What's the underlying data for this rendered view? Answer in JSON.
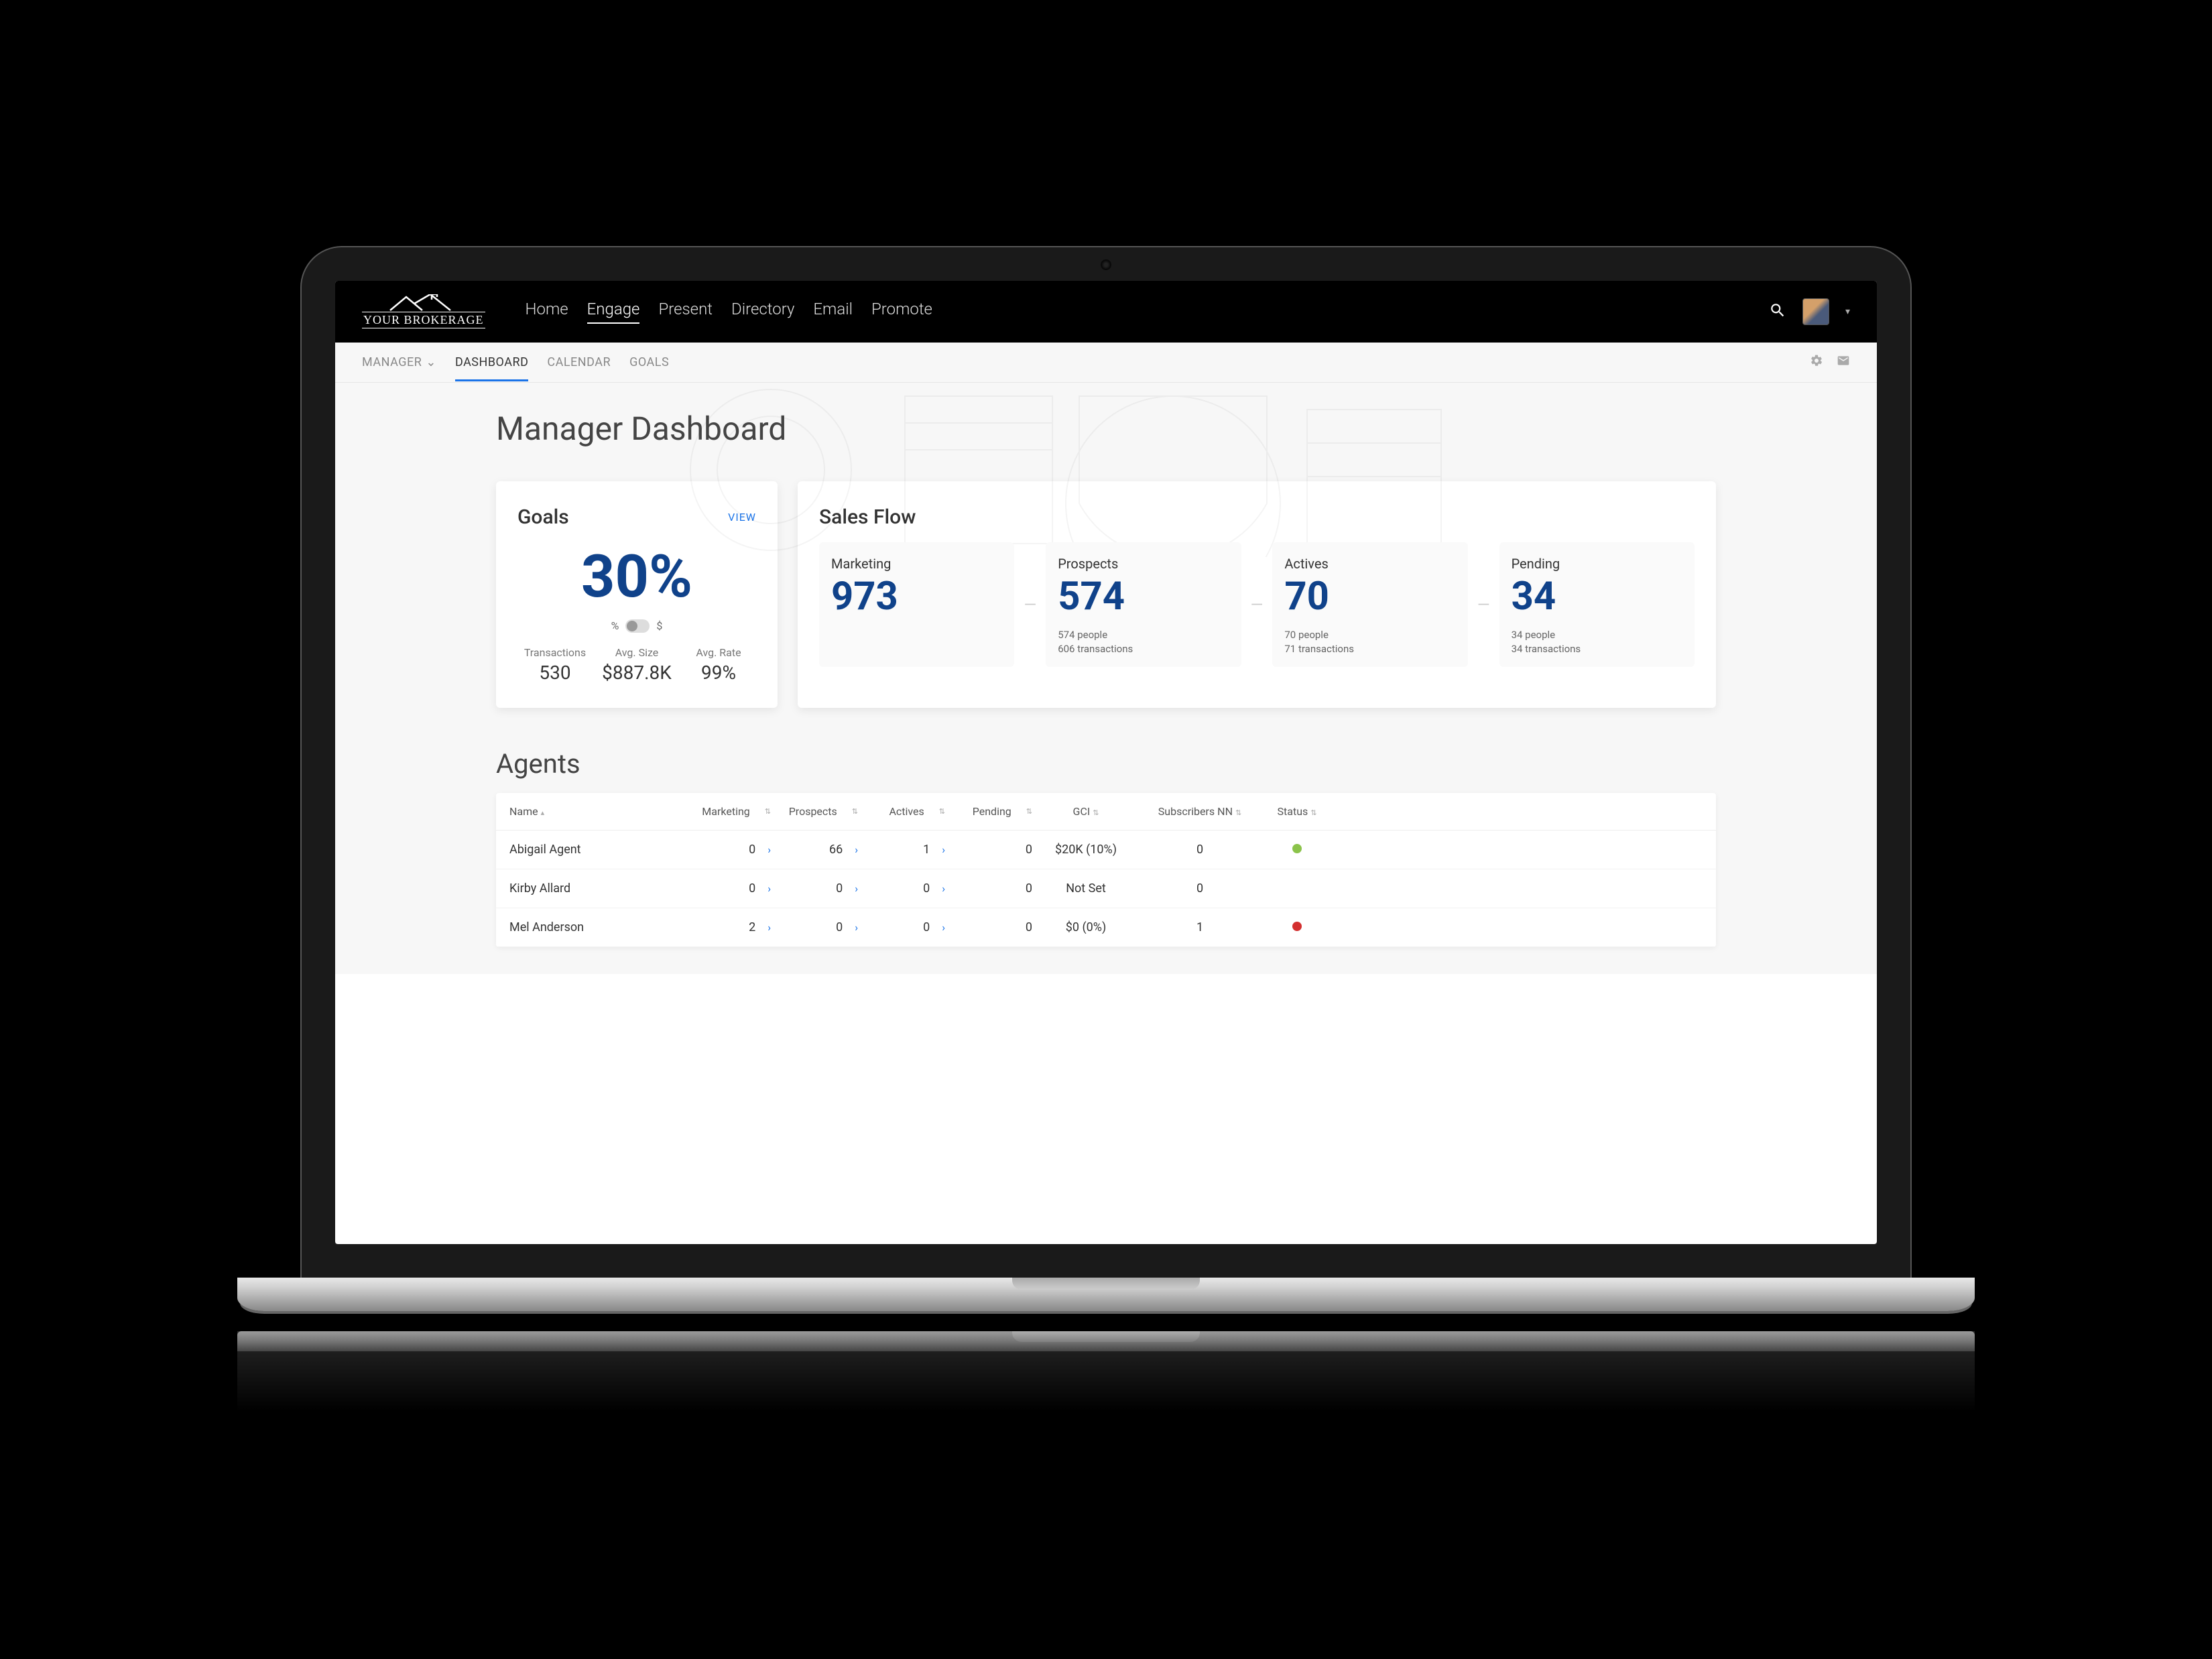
{
  "brand": "YOUR BROKERAGE",
  "nav": {
    "items": [
      "Home",
      "Engage",
      "Present",
      "Directory",
      "Email",
      "Promote"
    ],
    "active": "Engage"
  },
  "subnav": {
    "manager_label": "MANAGER",
    "items": [
      "DASHBOARD",
      "CALENDAR",
      "GOALS"
    ],
    "active": "DASHBOARD"
  },
  "page_title": "Manager Dashboard",
  "goals": {
    "title": "Goals",
    "view_label": "VIEW",
    "percent": "30%",
    "toggle_left": "%",
    "toggle_right": "$",
    "stats": [
      {
        "label": "Transactions",
        "value": "530"
      },
      {
        "label": "Avg. Size",
        "value": "$887.8K"
      },
      {
        "label": "Avg. Rate",
        "value": "99%"
      }
    ]
  },
  "sales_flow": {
    "title": "Sales Flow",
    "stages": [
      {
        "label": "Marketing",
        "value": "973",
        "sub1": "",
        "sub2": ""
      },
      {
        "label": "Prospects",
        "value": "574",
        "sub1": "574 people",
        "sub2": "606 transactions"
      },
      {
        "label": "Actives",
        "value": "70",
        "sub1": "70 people",
        "sub2": "71 transactions"
      },
      {
        "label": "Pending",
        "value": "34",
        "sub1": "34 people",
        "sub2": "34 transactions"
      }
    ]
  },
  "agents": {
    "title": "Agents",
    "columns": {
      "name": "Name",
      "marketing": "Marketing",
      "prospects": "Prospects",
      "actives": "Actives",
      "pending": "Pending",
      "gci": "GCI",
      "subscribers": "Subscribers NN",
      "status": "Status"
    },
    "rows": [
      {
        "name": "Abigail Agent",
        "marketing": "0",
        "prospects": "66",
        "actives": "1",
        "pending": "0",
        "gci": "$20K (10%)",
        "subscribers": "0",
        "status": "green"
      },
      {
        "name": "Kirby Allard",
        "marketing": "0",
        "prospects": "0",
        "actives": "0",
        "pending": "0",
        "gci": "Not Set",
        "subscribers": "0",
        "status": ""
      },
      {
        "name": "Mel Anderson",
        "marketing": "2",
        "prospects": "0",
        "actives": "0",
        "pending": "0",
        "gci": "$0 (0%)",
        "subscribers": "1",
        "status": "red"
      }
    ]
  }
}
